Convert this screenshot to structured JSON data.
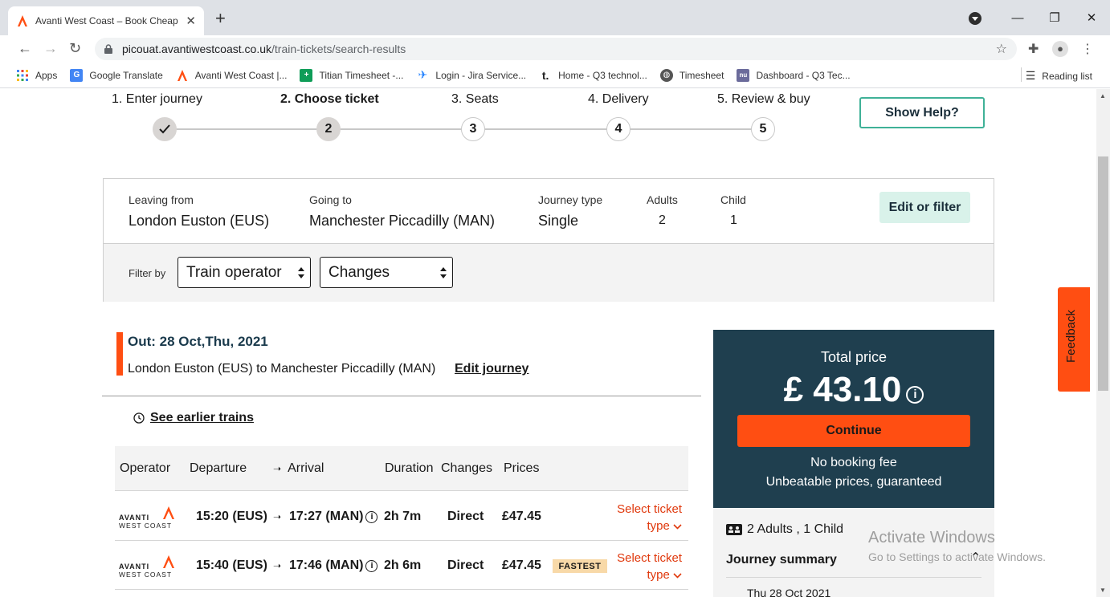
{
  "browser": {
    "tab_title": "Avanti West Coast – Book Cheap",
    "new_tab": "+",
    "url_host": "picouat.avantiwestcoast.co.uk",
    "url_path": "/train-tickets/search-results",
    "bookmarks": [
      {
        "label": "Apps",
        "icon": "apps-grid-icon",
        "color": "#4285f4"
      },
      {
        "label": "Google Translate",
        "icon": "google-translate-icon",
        "color": "#4285f4"
      },
      {
        "label": "Avanti West Coast |...",
        "icon": "avanti-logo-icon",
        "color": "#ff4e12"
      },
      {
        "label": "Titian Timesheet -...",
        "icon": "titian-plus-icon",
        "color": "#0f9d58"
      },
      {
        "label": "Login - Jira Service...",
        "icon": "jira-icon",
        "color": "#2684ff"
      },
      {
        "label": "Home - Q3 technol...",
        "icon": "t-logo-icon",
        "color": "#222222"
      },
      {
        "label": "Timesheet",
        "icon": "globe-icon",
        "color": "#555555"
      },
      {
        "label": "Dashboard - Q3 Tec...",
        "icon": "nu-logo-icon",
        "color": "#6b6b9b"
      }
    ],
    "reading_list": "Reading list"
  },
  "steps": [
    {
      "label": "1. Enter journey",
      "num": "",
      "state": "done"
    },
    {
      "label": "2. Choose ticket",
      "num": "2",
      "state": "active"
    },
    {
      "label": "3. Seats",
      "num": "3",
      "state": "todo"
    },
    {
      "label": "4. Delivery",
      "num": "4",
      "state": "todo"
    },
    {
      "label": "5. Review & buy",
      "num": "5",
      "state": "todo"
    }
  ],
  "help_button": "Show Help?",
  "journey": {
    "leaving_label": "Leaving from",
    "leaving_value": "London Euston (EUS)",
    "going_label": "Going to",
    "going_value": "Manchester Piccadilly (MAN)",
    "type_label": "Journey type",
    "type_value": "Single",
    "adults_label": "Adults",
    "adults_value": "2",
    "child_label": "Child",
    "child_value": "1",
    "edit_button": "Edit or filter"
  },
  "filters": {
    "label": "Filter by",
    "operator": "Train operator",
    "changes": "Changes"
  },
  "outbound": {
    "title": "Out: 28 Oct,Thu, 2021",
    "route": "London Euston (EUS) to Manchester Piccadilly (MAN)",
    "edit_link": "Edit journey",
    "earlier_link": "See earlier trains"
  },
  "table": {
    "headers": {
      "operator": "Operator",
      "departure": "Departure",
      "arrival": "Arrival",
      "duration": "Duration",
      "changes": "Changes",
      "prices": "Prices"
    },
    "rows": [
      {
        "operator_line1": "AVANTI",
        "operator_line2": "WEST COAST",
        "departure": "15:20 (EUS)",
        "arrival": "17:27 (MAN)",
        "duration": "2h 7m",
        "changes": "Direct",
        "price": "£47.45",
        "badge": "",
        "select_line1": "Select ticket",
        "select_line2": "type"
      },
      {
        "operator_line1": "AVANTI",
        "operator_line2": "WEST COAST",
        "departure": "15:40 (EUS)",
        "arrival": "17:46 (MAN)",
        "duration": "2h 6m",
        "changes": "Direct",
        "price": "£47.45",
        "badge": "FASTEST",
        "select_line1": "Select ticket",
        "select_line2": "type"
      }
    ]
  },
  "price_panel": {
    "total_label": "Total price",
    "total_amount": "£ 43.10",
    "continue": "Continue",
    "no_fee": "No booking fee",
    "unbeatable": "Unbeatable prices, guaranteed",
    "passengers": "2 Adults , 1 Child",
    "journey_summary": "Journey summary",
    "summary_date": "Thu 28 Oct 2021"
  },
  "feedback": "Feedback",
  "watermark": {
    "line1": "Activate Windows",
    "line2": "Go to Settings to activate Windows."
  },
  "colors": {
    "brand_orange": "#ff4e12",
    "panel_teal": "#1f3f4f",
    "help_border": "#3fb197",
    "edit_bg": "#d9f2ea",
    "select_red": "#e0380c",
    "fastest_bg": "#f8d9a8"
  }
}
